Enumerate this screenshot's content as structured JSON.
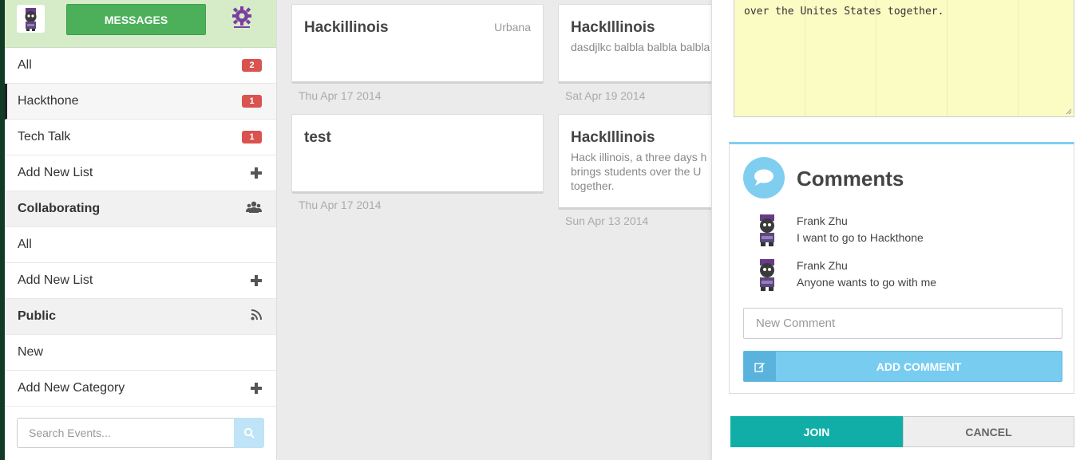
{
  "sidebar": {
    "messages_label": "MESSAGES",
    "rows": [
      {
        "label": "All",
        "badge": "2"
      },
      {
        "label": "Hackthone",
        "badge": "1"
      },
      {
        "label": "Tech Talk",
        "badge": "1"
      },
      {
        "label": "Add New List"
      }
    ],
    "collaborating": {
      "title": "Collaborating",
      "rows": [
        {
          "label": "All"
        },
        {
          "label": "Add New List"
        }
      ]
    },
    "public": {
      "title": "Public",
      "rows": [
        {
          "label": "New"
        },
        {
          "label": "Add New Category"
        }
      ]
    },
    "search_placeholder": "Search Events..."
  },
  "cards": [
    {
      "title": "Hackillinois",
      "location": "Urbana",
      "body": "",
      "date": "Thu Apr 17 2014"
    },
    {
      "title": "HackIllinois",
      "location": "",
      "body": "dasdjlkc balbla balbla balbla",
      "date": "Sat Apr 19 2014"
    },
    {
      "title": "test",
      "location": "",
      "body": "",
      "date": "Thu Apr 17 2014"
    },
    {
      "title": "HackIllinois",
      "location": "",
      "body_lines": [
        "Hack illinois, a three days h",
        "brings students over the U",
        "together."
      ],
      "date": "Sun Apr 13 2014"
    }
  ],
  "detail": {
    "description_tail": "over the Unites States  together.",
    "comments_title": "Comments",
    "comments": [
      {
        "author": "Frank Zhu",
        "text": "I want to go to Hackthone"
      },
      {
        "author": "Frank Zhu",
        "text": "Anyone wants to go with me"
      }
    ],
    "new_comment_placeholder": "New Comment",
    "add_comment_label": "ADD COMMENT",
    "join_label": "JOIN",
    "cancel_label": "CANCEL"
  },
  "colors": {
    "green_button": "#4cb05a",
    "header_bg": "#d6ecc8",
    "badge_red": "#d9534f",
    "accent_blue": "#7fcef0",
    "join_teal": "#10aea6",
    "gear_purple": "#7b3fa0"
  }
}
